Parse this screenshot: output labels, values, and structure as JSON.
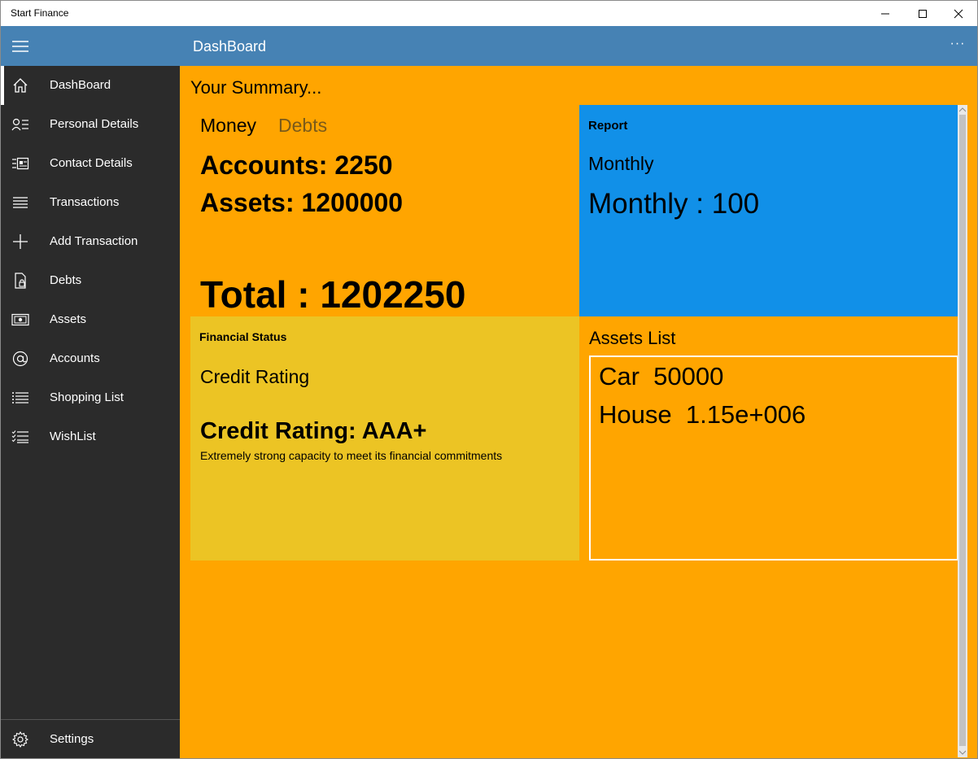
{
  "window": {
    "title": "Start Finance"
  },
  "header": {
    "title": "DashBoard",
    "more": "···"
  },
  "sidebar": {
    "items": [
      {
        "label": "DashBoard",
        "icon": "home-icon",
        "active": true
      },
      {
        "label": "Personal Details",
        "icon": "contact-card-icon"
      },
      {
        "label": "Contact Details",
        "icon": "address-book-icon"
      },
      {
        "label": "Transactions",
        "icon": "list-icon"
      },
      {
        "label": "Add Transaction",
        "icon": "plus-icon"
      },
      {
        "label": "Debts",
        "icon": "lock-document-icon"
      },
      {
        "label": "Assets",
        "icon": "money-icon"
      },
      {
        "label": "Accounts",
        "icon": "at-icon"
      },
      {
        "label": "Shopping List",
        "icon": "bulleted-list-icon"
      },
      {
        "label": "WishList",
        "icon": "checklist-icon"
      }
    ],
    "settings": {
      "label": "Settings",
      "icon": "gear-icon"
    }
  },
  "summary": {
    "title": "Your Summary...",
    "tabs": [
      "Money",
      "Debts"
    ],
    "accounts": "Accounts: 2250",
    "assets": "Assets: 1200000",
    "total": "Total : 1202250"
  },
  "report": {
    "title": "Report",
    "subtitle": "Monthly",
    "value": "Monthly : 100"
  },
  "financial_status": {
    "title": "Financial Status",
    "subtitle": "Credit Rating",
    "rating": "Credit Rating: AAA+",
    "description": "Extremely strong capacity to meet its financial commitments"
  },
  "assets_list": {
    "title": "Assets List",
    "items": [
      "Car  50000",
      "House  1.15e+006"
    ]
  },
  "colors": {
    "header": "#4682b4",
    "sidebar": "#2b2b2b",
    "content": "#ffa500",
    "report": "#1190e8",
    "status": "#ecc424"
  }
}
